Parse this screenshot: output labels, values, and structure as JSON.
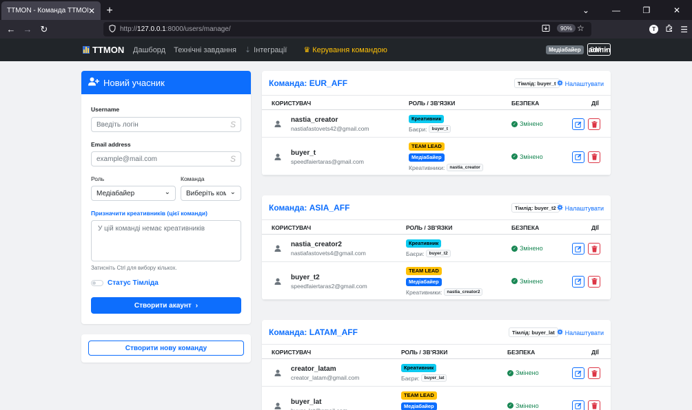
{
  "browser": {
    "tab_title": "TTMON - Команда TTMON",
    "url_prefix": "http://",
    "url_host": "127.0.0.1",
    "url_rest": ":8000/users/manage/",
    "zoom": "90%"
  },
  "header": {
    "brand": "TTMON",
    "menu": [
      "Дашборд",
      "Технічні завдання",
      "Інтеграції",
      "Керування командою"
    ],
    "role_badge": "Медіабайер",
    "username": "admin",
    "logout": "Вийти"
  },
  "form": {
    "title": "Новий учасник",
    "username_label": "Username",
    "username_placeholder": "Введіть логін",
    "email_label": "Email address",
    "email_placeholder": "example@mail.com",
    "role_label": "Роль",
    "role_value": "Медіабайер",
    "team_label": "Команда",
    "team_value": "Виберіть команду",
    "assign_label": "Призначити креативників (цієї команди)",
    "assign_empty": "У цій команді немає креативників",
    "assign_hint": "Затисніть Ctrl для вибору кількох.",
    "teamlead_label": "Статус Тімліда",
    "submit": "Створити акаунт"
  },
  "new_team_button": "Створити нову команду",
  "columns": {
    "user": "КОРИСТУВАЧ",
    "role": "РОЛЬ / ЗВ'ЯЗКИ",
    "security": "БЕЗПЕКА",
    "actions": "ДІЇ"
  },
  "labels": {
    "settings": "Налаштувати",
    "buyers": "Баєри:",
    "creatives": "Креативники:",
    "changed": "Змінено",
    "role_creative": "Креативник",
    "role_teamlead": "TEAM LEAD",
    "role_buyer": "Медіабайер"
  },
  "teams": [
    {
      "title": "Команда: EUR_AFF",
      "lead": "Тімлід: buyer_t",
      "users": [
        {
          "name": "nastia_creator",
          "email": "nastiafastovets42@gmail.com",
          "rel": "buyer_t"
        },
        {
          "name": "buyer_t",
          "email": "speedfaiertaras@gmail.com",
          "rel": "nastia_creator"
        }
      ]
    },
    {
      "title": "Команда: ASIA_AFF",
      "lead": "Тімлід: buyer_t2",
      "users": [
        {
          "name": "nastia_creator2",
          "email": "nastiafastovets4@gmail.com",
          "rel": "buyer_t2"
        },
        {
          "name": "buyer_t2",
          "email": "speedfaiertaras2@gmail.com",
          "rel": "nastia_creator2"
        }
      ]
    },
    {
      "title": "Команда: LATAM_AFF",
      "lead": "Тімлід: buyer_lat",
      "users": [
        {
          "name": "creator_latam",
          "email": "creator_latam@gmail.com",
          "rel": "buyer_lat"
        },
        {
          "name": "buyer_lat",
          "email": "buyer_lat@gmail.com",
          "rel": ""
        }
      ]
    }
  ]
}
